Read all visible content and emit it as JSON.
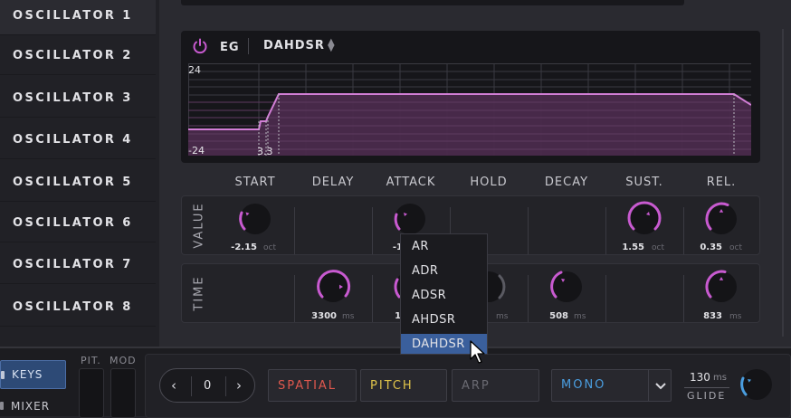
{
  "sidebar": {
    "oscillators": [
      "OSCILLATOR 1",
      "OSCILLATOR 2",
      "OSCILLATOR 3",
      "OSCILLATOR 4",
      "OSCILLATOR 5",
      "OSCILLATOR 6",
      "OSCILLATOR 7",
      "OSCILLATOR 8"
    ]
  },
  "eg": {
    "label": "EG",
    "mode": "DAHDSR",
    "y_max_label": "24",
    "y_min_label": "-24",
    "marker_label": "3.3"
  },
  "columns": [
    "START",
    "DELAY",
    "ATTACK",
    "HOLD",
    "DECAY",
    "SUST.",
    "REL."
  ],
  "rows": {
    "value_label": "VALUE",
    "time_label": "TIME",
    "value": {
      "start": {
        "value": "-2.15",
        "unit": "oct"
      },
      "attack": {
        "value": "-1",
        "unit": ""
      },
      "sustain": {
        "value": "1.55",
        "unit": "oct"
      },
      "release": {
        "value": "0.35",
        "unit": "oct"
      }
    },
    "time": {
      "delay": {
        "value": "3300",
        "unit": "ms"
      },
      "attack": {
        "value": "10",
        "unit": ""
      },
      "hold": {
        "value": "",
        "unit": "ms"
      },
      "decay": {
        "value": "508",
        "unit": "ms"
      },
      "release": {
        "value": "833",
        "unit": "ms"
      }
    }
  },
  "dropdown": {
    "options": [
      "AR",
      "ADR",
      "ADSR",
      "AHDSR",
      "DAHDSR"
    ],
    "selected": "DAHDSR"
  },
  "bottom": {
    "keys_label": "KEYS",
    "mixer_label": "MIXER",
    "pit_label": "PIT.",
    "mod_label": "MOD",
    "stepper_value": "0",
    "spatial_label": "SPATIAL",
    "pitch_label": "PITCH",
    "arp_label": "ARP",
    "mono_label": "MONO",
    "glide_value": "130",
    "glide_unit": "ms",
    "glide_label": "GLIDE"
  },
  "colors": {
    "accent": "#c85ad0",
    "selection": "#3a5f9c",
    "spatial": "#e0584e",
    "pitch": "#e0c44a",
    "mono": "#4a9ee0"
  }
}
